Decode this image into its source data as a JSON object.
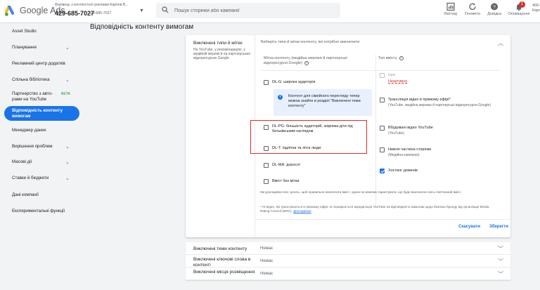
{
  "header": {
    "brand": "Google Ads",
    "account_name": "Фахівець з контекстної реклами Карпов В...",
    "account_id": "429-685-7027",
    "account_sub_id": "429-685-7027",
    "search_placeholder": "Пошук сторінки або кампанії",
    "tools": [
      {
        "label": "Вигляд",
        "icon": "chart-icon"
      },
      {
        "label": "Оновити",
        "icon": "refresh-icon"
      },
      {
        "label": "Довідка",
        "icon": "help-icon"
      },
      {
        "label": "Оповіщення",
        "icon": "bell-icon",
        "badge": "1"
      }
    ],
    "account_right": "400-\nКарп"
  },
  "sidebar": {
    "items": [
      {
        "label": "Asset Studio",
        "chevron": false
      },
      {
        "label": "Планування",
        "chevron": true
      },
      {
        "label": "Рекламний центр додатків",
        "chevron": false
      },
      {
        "label": "Спільна бібліотека",
        "chevron": true
      },
      {
        "label": "Партнерство з авто-\nрами на YouTube",
        "chevron": false,
        "beta": "BETA"
      },
      {
        "label": "Відповідність контенту\nвимогам",
        "active": true
      },
      {
        "label": "Менеджер даних",
        "chevron": false
      },
      {
        "label": "Вирішення проблем",
        "chevron": true
      },
      {
        "label": "Масові дії",
        "chevron": true
      },
      {
        "label": "Ставки й бюджети",
        "chevron": true
      },
      {
        "label": "Дані компанії",
        "chevron": false
      },
      {
        "label": "Експериментальні функції",
        "chevron": false
      }
    ]
  },
  "page": {
    "title": "Відповідність контенту вимогам"
  },
  "card": {
    "title": "Виключені типи й мітки",
    "description": "На YouTube, у рекомендаціях, у медійній мережі й на партнерських відеоресурсах Google",
    "header": "Виберіть типи й мітки контенту, які потрібно виключити",
    "col1_head": "Мітка контенту (медійна мережа й партнерські відеоресурси Google)",
    "col2_head": "Тип вмісту",
    "labels": [
      {
        "text": "DL-G: широка аудиторія",
        "checked": false
      },
      {
        "text": "DL-PG: більшість аудиторій, зокрема діти під батьківським наглядом",
        "checked": false
      },
      {
        "text": "DL-T: підлітки та літні люди",
        "checked": false
      },
      {
        "text": "DL-MA: дорослі",
        "checked": false
      },
      {
        "text": "Вміст без мітки",
        "checked": false
      }
    ],
    "info_text": "Контент для сімейного перегляду тепер можна знайти в розділі \"Виключені теми контенту\"",
    "types": [
      {
        "text": "Ігри",
        "sub": "",
        "warning": "Неактивно",
        "checked": false,
        "disabled": true
      },
      {
        "text": "Трансляція відео в прямому ефірі*",
        "sub": "(YouTube, медійна мережа й партнерські відеоресурси Google)",
        "checked": false
      },
      {
        "text": "Вбудовані відео YouTube",
        "sub": "(YouTube)",
        "checked": false
      },
      {
        "text": "Нижня частина сторінки",
        "sub": "(Медійна кампанія)",
        "checked": false
      },
      {
        "text": "Хостинг доменів",
        "sub": "",
        "checked": true
      }
    ],
    "footnote1": "Ми докладемо всіх зусиль, щоб правильно виключати вміст, однак не можемо гарантувати, що буде виключено весь пов'язаний вміст.",
    "footnote2": "* Ні відео, які транслюються в прямому ефірі, ні поширюється акредитація YouTube на відповідність вимогам щодо безпеки бренду від організації Media Rating Council (MRC).",
    "footnote_link": "Докладніше",
    "cancel": "Скасувати",
    "save": "Зберегти"
  },
  "rows": [
    {
      "label": "Виключені теми контенту",
      "value": "Немає"
    },
    {
      "label": "Виключені ключові слова в контенті",
      "value": "Немає"
    },
    {
      "label": "Виключені місця розміщення",
      "value": "Немає"
    }
  ],
  "colors": {
    "accent": "#1a73e8",
    "highlight": "#d93025",
    "info_bg": "#e8f0fe"
  }
}
